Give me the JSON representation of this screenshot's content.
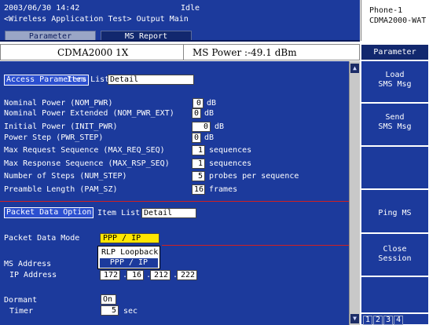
{
  "header": {
    "datetime": "2003/06/30 14:42",
    "status": "Idle",
    "app_title": "<Wireless Application Test> Output Main",
    "tabs": [
      "Parameter",
      "MS Report"
    ]
  },
  "phone": {
    "line1": "Phone-1",
    "line2": "CDMA2000-WAT"
  },
  "infobar": {
    "standard": "CDMA2000 1X",
    "ms_power": "MS Power :-49.1 dBm"
  },
  "access": {
    "heading": "Access Parameters",
    "item_list_label": "Item List",
    "item_list_value": "Detail",
    "rows": [
      {
        "label": "Nominal Power (NOM_PWR)",
        "value": "0",
        "unit": "dB"
      },
      {
        "label": "Nominal Power Extended (NOM_PWR_EXT)",
        "value": "0",
        "unit": "dB"
      },
      {
        "label": "Initial Power (INIT_PWR)",
        "value": "0",
        "unit": "dB"
      },
      {
        "label": "Power Step (PWR_STEP)",
        "value": "0",
        "unit": "dB"
      },
      {
        "label": "Max Request Sequence (MAX_REQ_SEQ)",
        "value": "1",
        "unit": "sequences"
      },
      {
        "label": "Max Response Sequence (MAX_RSP_SEQ)",
        "value": "1",
        "unit": "sequences"
      },
      {
        "label": "Number of Steps (NUM_STEP)",
        "value": "5",
        "unit": "probes per sequence"
      },
      {
        "label": "Preamble Length (PAM_SZ)",
        "value": "16",
        "unit": "frames"
      }
    ]
  },
  "packet": {
    "heading": "Packet Data Option",
    "item_list_label": "Item List",
    "item_list_value": "Detail",
    "mode_label": "Packet Data Mode",
    "mode_value": "PPP / IP",
    "dropdown_options": [
      "RLP Loopback",
      "PPP / IP"
    ],
    "ms_address_label": "MS Address",
    "ip_label": "IP Address",
    "ip": [
      "172",
      "16",
      "212",
      "222"
    ],
    "dormant_label": "Dormant",
    "dormant_value": "On",
    "timer_label": "Timer",
    "timer_value": "5",
    "timer_unit": "sec"
  },
  "side": {
    "title": "Parameter",
    "buttons": [
      {
        "line1": "Load",
        "line2": "SMS Msg"
      },
      {
        "line1": "Send",
        "line2": "SMS Msg"
      },
      {
        "line1": "",
        "line2": ""
      },
      {
        "line1": "Ping MS",
        "line2": ""
      },
      {
        "line1": "Close",
        "line2": "Session"
      },
      {
        "line1": "",
        "line2": ""
      }
    ],
    "pages": [
      "1",
      "2",
      "3",
      "4"
    ]
  },
  "colors": {
    "panel": "#1c3a9c",
    "highlight": "#ffe600",
    "separator": "#d02020"
  }
}
